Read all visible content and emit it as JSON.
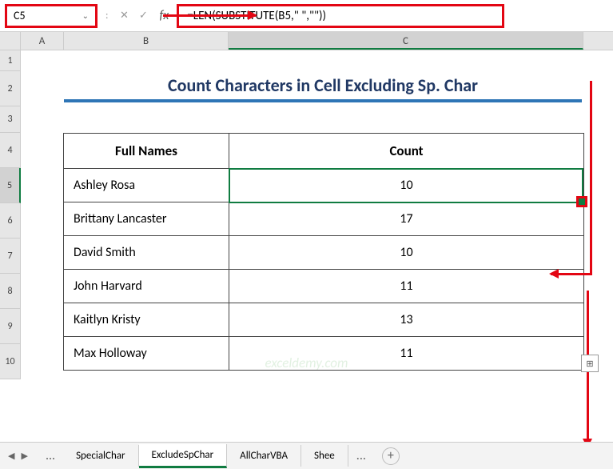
{
  "nameBox": "C5",
  "formula": "=LEN(SUBSTITUTE(B5,\" \",\"\"))",
  "columns": [
    "A",
    "B",
    "C"
  ],
  "rowNumbers": [
    "1",
    "2",
    "3",
    "4",
    "5",
    "6",
    "7",
    "8",
    "9",
    "10"
  ],
  "activeRow": "5",
  "activeCol": "C",
  "title": "Count Characters in Cell Excluding Sp. Char",
  "headers": {
    "names": "Full Names",
    "count": "Count"
  },
  "rows": [
    {
      "name": "Ashley Rosa",
      "count": "10"
    },
    {
      "name": "Brittany Lancaster",
      "count": "17"
    },
    {
      "name": "David Smith",
      "count": "10"
    },
    {
      "name": "John Harvard",
      "count": "11"
    },
    {
      "name": "Kaitlyn Kristy",
      "count": "13"
    },
    {
      "name": "Max Holloway",
      "count": "11"
    }
  ],
  "watermark": "exceldemy.com",
  "tabs": {
    "prev_ellipsis": "...",
    "t1": "SpecialChar",
    "t2": "ExcludeSpChar",
    "t3": "AllCharVBA",
    "t4": "Shee",
    "next_ellipsis": "..."
  },
  "icons": {
    "chev": "⌄",
    "cancel": "✕",
    "accept": "✓",
    "fx": "fx",
    "nav_left": "◀",
    "nav_right": "▶",
    "plus": "+",
    "autofill": "⊞"
  }
}
